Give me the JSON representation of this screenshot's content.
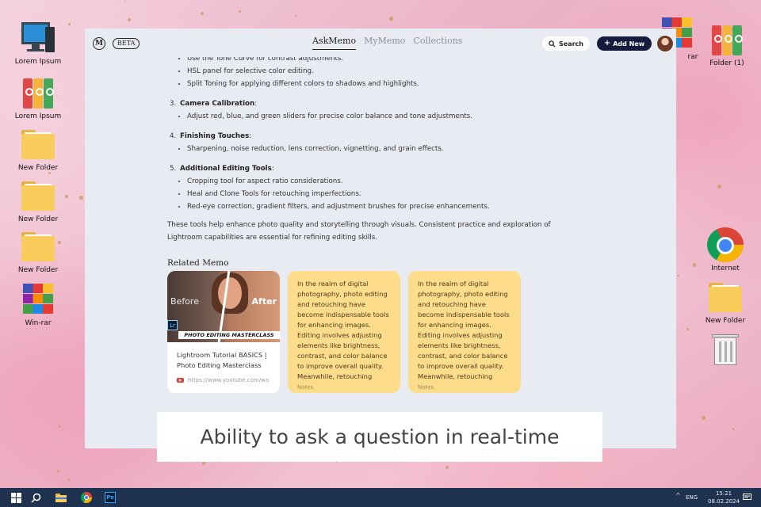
{
  "desktop": {
    "icons_left": [
      {
        "label": "Lorem Ipsum",
        "icon": "computer-icon"
      },
      {
        "label": "Lorem Ipsum",
        "icon": "binders-icon"
      },
      {
        "label": "New Folder",
        "icon": "folder-icon"
      },
      {
        "label": "New Folder",
        "icon": "folder-icon"
      },
      {
        "label": "New Folder",
        "icon": "folder-icon"
      },
      {
        "label": "Win-rar",
        "icon": "winrar-icon"
      }
    ],
    "icons_right": [
      {
        "label": "rar",
        "icon": "winrar-icon"
      },
      {
        "label": "Folder (1)",
        "icon": "binders-icon"
      },
      {
        "label": "Internet",
        "icon": "chrome-icon"
      },
      {
        "label": "New Folder",
        "icon": "folder-icon"
      },
      {
        "label": "",
        "icon": "recycle-bin-icon"
      }
    ]
  },
  "app": {
    "logo": "M",
    "beta": "BETA",
    "tabs": [
      {
        "label": "AskMemo",
        "active": true
      },
      {
        "label": "MyMemo",
        "active": false
      },
      {
        "label": "Collections",
        "active": false
      }
    ],
    "search_label": "Search",
    "add_new_label": "Add New"
  },
  "content": {
    "top_bullets": [
      "Use the Tone Curve for contrast adjustments.",
      "HSL panel for selective color editing.",
      "Split Toning for applying different colors to shadows and highlights."
    ],
    "sections": [
      {
        "number": "3.",
        "title": "Camera Calibration",
        "bullets": [
          "Adjust red, blue, and green sliders for precise color balance and tone adjustments."
        ]
      },
      {
        "number": "4.",
        "title": "Finishing Touches",
        "bullets": [
          "Sharpening, noise reduction, lens correction, vignetting, and grain effects."
        ]
      },
      {
        "number": "5.",
        "title": "Additional Editing Tools",
        "bullets": [
          "Cropping tool for aspect ratio considerations.",
          "Heal and Clone Tools for retouching imperfections.",
          "Red-eye correction, gradient filters, and adjustment brushes for precise enhancements."
        ]
      }
    ],
    "summary": "These tools help enhance photo quality and storytelling through visuals. Consistent practice and exploration of Lightroom capabilities are essential for refining editing skills.",
    "related_title": "Related Memo",
    "video_card": {
      "before": "Before",
      "after": "After",
      "lr": "Lr",
      "banner": "PHOTO EDITING MASTERCLASS",
      "title": "Lightroom Tutorial BASICS | Photo Editing Masterclass",
      "link": "https://www.youtube.com/wa"
    },
    "note_cards": [
      {
        "text": "In the realm of digital photography, photo editing and retouching have become indispensable tools for enhancing images. Editing involves adjusting elements like brightness, contrast, and color balance to improve overall quality. Meanwhile, retouching focuses on",
        "footer": "Notes"
      },
      {
        "text": "In the realm of digital photography, photo editing and retouching have become indispensable tools for enhancing images. Editing involves adjusting elements like brightness, contrast, and color balance to improve overall quality. Meanwhile, retouching focuses on",
        "footer": "Notes"
      }
    ]
  },
  "caption": "Ability to ask a question in real-time",
  "taskbar": {
    "apps": [
      "windows-start-icon",
      "search-icon",
      "file-explorer-icon",
      "chrome-icon",
      "photoshop-icon"
    ],
    "photoshop_label": "Ps",
    "lang": "ENG",
    "time": "15:21",
    "date": "08.02.2024"
  },
  "colors": {
    "accent_dark": "#141b3c",
    "note_yellow": "#fddc8c",
    "app_bg": "#e8ebf1",
    "taskbar": "#1f3350"
  }
}
